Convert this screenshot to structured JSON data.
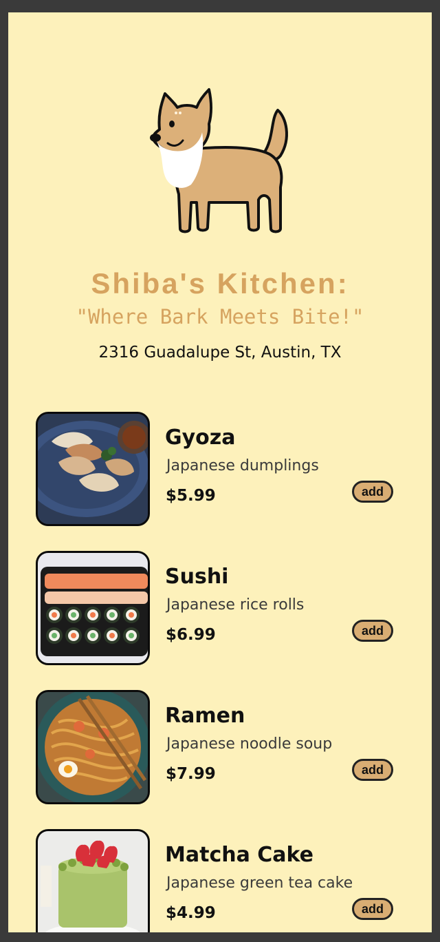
{
  "header": {
    "title": "Shiba's Kitchen:",
    "tagline": "\"Where Bark Meets Bite!\"",
    "address": "2316 Guadalupe St, Austin, TX"
  },
  "menu": {
    "items": [
      {
        "name": "Gyoza",
        "description": "Japanese dumplings",
        "price": "$5.99",
        "add_label": "add",
        "image": "gyoza-photo"
      },
      {
        "name": "Sushi",
        "description": "Japanese rice rolls",
        "price": "$6.99",
        "add_label": "add",
        "image": "sushi-photo"
      },
      {
        "name": "Ramen",
        "description": "Japanese noodle soup",
        "price": "$7.99",
        "add_label": "add",
        "image": "ramen-photo"
      },
      {
        "name": "Matcha Cake",
        "description": "Japanese green tea cake",
        "price": "$4.99",
        "add_label": "add",
        "image": "matcha-cake-photo"
      }
    ]
  },
  "colors": {
    "background": "#fdf1bb",
    "accent": "#d6a35f",
    "button": "#d9ad73",
    "frame": "#3a3a3a"
  }
}
